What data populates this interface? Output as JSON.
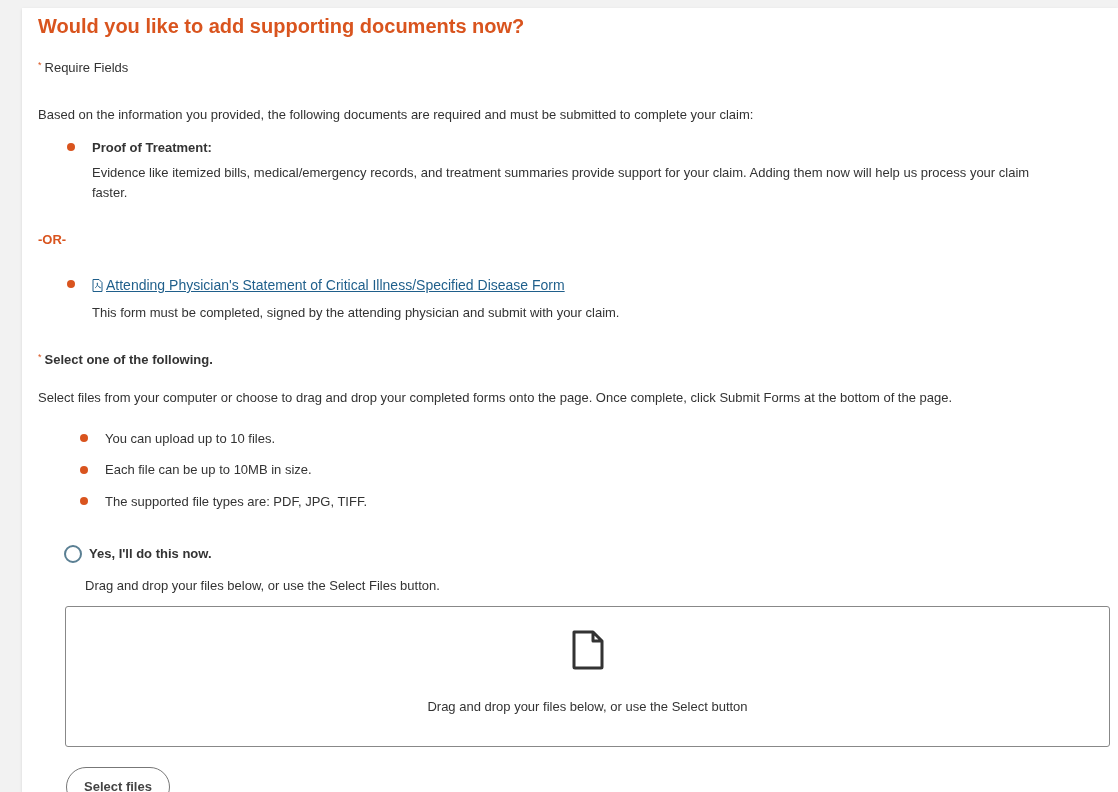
{
  "heading": "Would you like to add supporting documents now?",
  "required_note": {
    "mark": "*",
    "text": "Require Fields"
  },
  "intro": "Based on the information you provided, the following documents are required and must be submitted to complete your claim:",
  "documents": [
    {
      "kind": "text",
      "title": "Proof of Treatment:",
      "description": "Evidence like itemized bills, medical/emergency records, and treatment summaries provide support for your claim. Adding them now will help us process your claim faster."
    },
    {
      "kind": "separator",
      "title": "-OR-"
    },
    {
      "kind": "link",
      "title": "Attending Physician's Statement of Critical Illness/Specified Disease Form",
      "description": "This form must be completed, signed by the attending physician and submit with your claim."
    }
  ],
  "select_prompt": {
    "mark": "*",
    "text": "Select one of the following."
  },
  "instructions": "Select files from your computer or choose to drag and drop your completed forms onto the page. Once complete, click Submit Forms at the bottom of the page.",
  "rules": [
    "You can upload up to 10 files.",
    "Each file can be up to 10MB in size.",
    "The supported file types are: PDF, JPG, TIFF."
  ],
  "options": [
    {
      "label": "Yes, I'll do this now.",
      "selected": false,
      "hint": "Drag and drop your files below, or use the Select Files button."
    }
  ],
  "dropzone": {
    "text": "Drag and drop your files below, or use the Select button"
  },
  "select_button": "Select files"
}
